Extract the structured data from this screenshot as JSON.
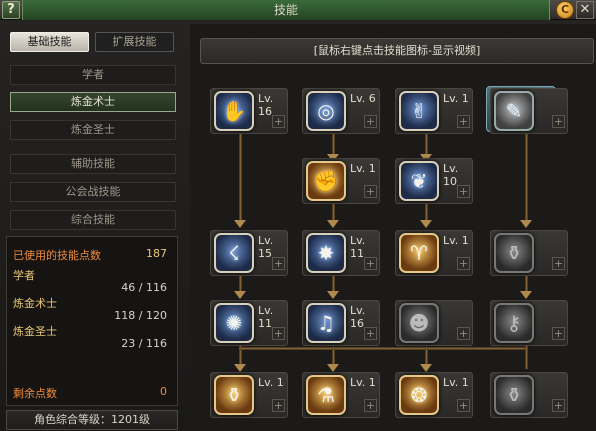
{
  "window": {
    "title": "技能",
    "help_glyph": "?",
    "coin_glyph": "C",
    "close_glyph": "✕"
  },
  "tabs": {
    "basic": "基础技能",
    "advanced": "扩展技能"
  },
  "jobs": [
    "学者",
    "炼金术士",
    "炼金圣士",
    "辅助技能",
    "公会战技能",
    "综合技能"
  ],
  "stats": {
    "used_label": "已使用的技能点数",
    "used_value": "187",
    "rows": [
      {
        "label": "学者",
        "value": "46 / 116"
      },
      {
        "label": "炼金术士",
        "value": "118 / 120"
      },
      {
        "label": "炼金圣士",
        "value": "23 / 116"
      }
    ],
    "remaining_label": "剩余点数",
    "remaining_value": "0"
  },
  "level_text": "角色综合等级：1201级",
  "hint": "[鼠标右键点击技能图标-显示视频]",
  "skills": [
    {
      "lv": "Lv. 16",
      "glyph": "✋",
      "style": "cool",
      "name": "skill-1-1"
    },
    {
      "lv": "Lv. 6",
      "glyph": "◎",
      "style": "cool",
      "name": "skill-1-2"
    },
    {
      "lv": "Lv. 1",
      "glyph": "✌",
      "style": "cool",
      "name": "skill-1-3"
    },
    {
      "lv": "",
      "glyph": "✎",
      "style": "special",
      "name": "skill-1-4"
    },
    {
      "lv": "Lv. 1",
      "glyph": "✊",
      "style": "warm",
      "name": "skill-2-2"
    },
    {
      "lv": "Lv. 10",
      "glyph": "❦",
      "style": "cool",
      "name": "skill-2-3"
    },
    {
      "lv": "Lv. 15",
      "glyph": "☇",
      "style": "cool",
      "name": "skill-3-1"
    },
    {
      "lv": "Lv. 11",
      "glyph": "✸",
      "style": "cool",
      "name": "skill-3-2"
    },
    {
      "lv": "Lv. 1",
      "glyph": "♈",
      "style": "warm",
      "name": "skill-3-3"
    },
    {
      "lv": "",
      "glyph": "⚱",
      "style": "locked",
      "name": "skill-3-4"
    },
    {
      "lv": "Lv. 11",
      "glyph": "✺",
      "style": "cool",
      "name": "skill-4-1"
    },
    {
      "lv": "Lv. 16",
      "glyph": "♫",
      "style": "cool",
      "name": "skill-4-2"
    },
    {
      "lv": "",
      "glyph": "☻",
      "style": "locked",
      "name": "skill-4-3"
    },
    {
      "lv": "",
      "glyph": "⚷",
      "style": "locked",
      "name": "skill-4-4"
    },
    {
      "lv": "Lv. 1",
      "glyph": "⚱",
      "style": "warm",
      "name": "skill-5-1"
    },
    {
      "lv": "Lv. 1",
      "glyph": "⚗",
      "style": "warm",
      "name": "skill-5-2"
    },
    {
      "lv": "Lv. 1",
      "glyph": "❂",
      "style": "warm",
      "name": "skill-5-3"
    },
    {
      "lv": "",
      "glyph": "⚱",
      "style": "locked",
      "name": "skill-5-4"
    }
  ],
  "plus_glyph": "+"
}
